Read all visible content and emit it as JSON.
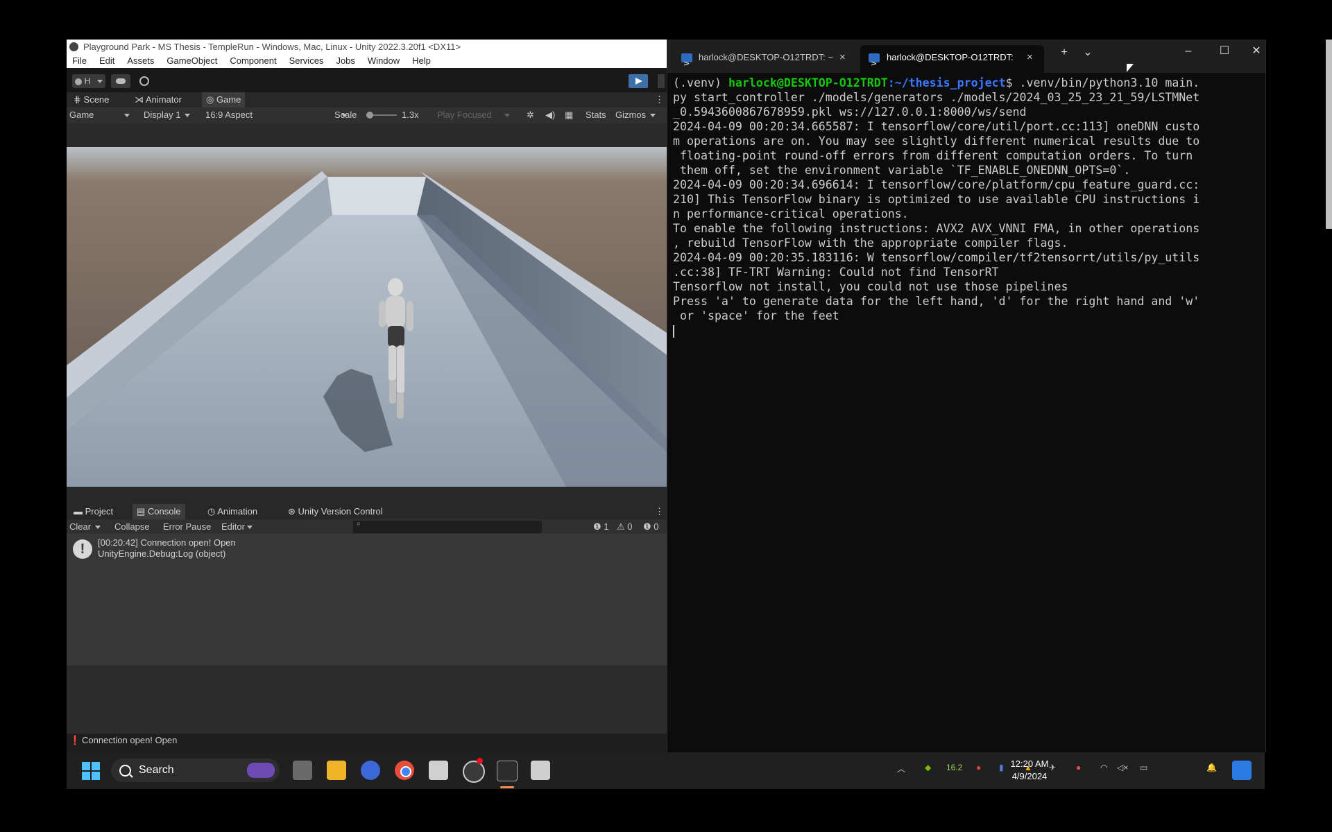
{
  "unity": {
    "title": "Playground Park - MS Thesis - TempleRun - Windows, Mac, Linux - Unity 2022.3.20f1 <DX11>",
    "menu": [
      "File",
      "Edit",
      "Assets",
      "GameObject",
      "Component",
      "Services",
      "Jobs",
      "Window",
      "Help"
    ],
    "toolbar": {
      "account_label": "H"
    },
    "tabs": [
      "Scene",
      "Animator",
      "Game"
    ],
    "gamebar": {
      "mode": "Game",
      "display": "Display 1",
      "aspect": "16:9 Aspect",
      "scale_label": "Scale",
      "scale_value": "1.3x",
      "play_mode": "Play Focused",
      "stats": "Stats",
      "gizmos": "Gizmos"
    },
    "bottom_tabs": [
      "Project",
      "Console",
      "Animation",
      "Unity Version Control"
    ],
    "console_bar": {
      "clear": "Clear",
      "collapse": "Collapse",
      "error_pause": "Error Pause",
      "editor": "Editor",
      "count_log": "1",
      "count_warn": "0",
      "count_error": "0"
    },
    "console_entries": [
      {
        "line1": "[00:20:42] Connection open! Open",
        "line2": "UnityEngine.Debug:Log (object)"
      }
    ],
    "status": "Connection open! Open"
  },
  "terminal": {
    "tabs": [
      {
        "label": "harlock@DESKTOP-O12TRDT: ~"
      },
      {
        "label": "harlock@DESKTOP-O12TRDT:"
      }
    ],
    "prompt_venv": "(.venv) ",
    "prompt_user": "harlock@DESKTOP-O12TRDT",
    "prompt_path": ":~/thesis_project",
    "prompt_cmd": "$ .venv/bin/python3.10 main.",
    "lines": [
      "py start_controller ./models/generators ./models/2024_03_25_23_21_59/LSTMNet",
      "_0.5943600867678959.pkl ws://127.0.0.1:8000/ws/send",
      "2024-04-09 00:20:34.665587: I tensorflow/core/util/port.cc:113] oneDNN custo",
      "m operations are on. You may see slightly different numerical results due to",
      " floating-point round-off errors from different computation orders. To turn",
      " them off, set the environment variable `TF_ENABLE_ONEDNN_OPTS=0`.",
      "2024-04-09 00:20:34.696614: I tensorflow/core/platform/cpu_feature_guard.cc:",
      "210] This TensorFlow binary is optimized to use available CPU instructions i",
      "n performance-critical operations.",
      "To enable the following instructions: AVX2 AVX_VNNI FMA, in other operations",
      ", rebuild TensorFlow with the appropriate compiler flags.",
      "2024-04-09 00:20:35.183116: W tensorflow/compiler/tf2tensorrt/utils/py_utils",
      ".cc:38] TF-TRT Warning: Could not find TensorRT",
      "Tensorflow not install, you could not use those pipelines",
      "Press 'a' to generate data for the left hand, 'd' for the right hand and 'w'",
      " or 'space' for the feet"
    ]
  },
  "taskbar": {
    "search_label": "Search",
    "tray": {
      "gpu_temp": "16.2",
      "time": "12:20 AM",
      "date": "4/9/2024"
    }
  },
  "colors": {
    "terminal_green": "#16c60c",
    "terminal_blue": "#3b78ff",
    "unity_play": "#3d6fa8"
  }
}
